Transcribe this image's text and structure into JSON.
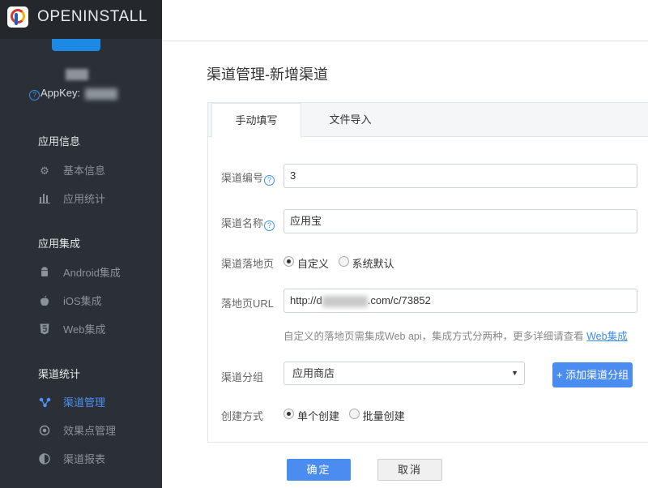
{
  "brand": {
    "name": "OPENINSTALL",
    "logo_icon": "openinstall-logo-icon"
  },
  "app": {
    "appkey_label": "AppKey:"
  },
  "sidebar": {
    "groups": [
      {
        "title": "应用信息",
        "items": [
          {
            "label": "基本信息",
            "icon": "gear-icon"
          },
          {
            "label": "应用统计",
            "icon": "bar-chart-icon"
          }
        ]
      },
      {
        "title": "应用集成",
        "items": [
          {
            "label": "Android集成",
            "icon": "android-icon"
          },
          {
            "label": "iOS集成",
            "icon": "apple-icon"
          },
          {
            "label": "Web集成",
            "icon": "html5-icon"
          }
        ]
      },
      {
        "title": "渠道统计",
        "items": [
          {
            "label": "渠道管理",
            "icon": "channel-icon",
            "active": true
          },
          {
            "label": "效果点管理",
            "icon": "target-icon"
          },
          {
            "label": "渠道报表",
            "icon": "pie-chart-icon"
          }
        ]
      }
    ]
  },
  "page": {
    "title": "渠道管理-新增渠道"
  },
  "tabs": [
    {
      "label": "手动填写",
      "active": true
    },
    {
      "label": "文件导入",
      "active": false
    }
  ],
  "form": {
    "channel_code": {
      "label": "渠道编号",
      "value": "3"
    },
    "channel_name": {
      "label": "渠道名称",
      "value": "应用宝"
    },
    "landing_page": {
      "label": "渠道落地页",
      "options": [
        {
          "label": "自定义",
          "checked": true
        },
        {
          "label": "系统默认",
          "checked": false
        }
      ]
    },
    "landing_url": {
      "label": "落地页URL",
      "value_prefix": "http://d",
      "value_suffix": ".com/c/73852"
    },
    "hint": {
      "text": "自定义的落地页需集成Web api，集成方式分两种，更多详细请查看 ",
      "link": "Web集成"
    },
    "channel_group": {
      "label": "渠道分组",
      "selected": "应用商店",
      "add_button": "+ 添加渠道分组"
    },
    "create_mode": {
      "label": "创建方式",
      "options": [
        {
          "label": "单个创建",
          "checked": true
        },
        {
          "label": "批量创建",
          "checked": false
        }
      ]
    }
  },
  "actions": {
    "confirm": "确定",
    "cancel": "取消"
  },
  "colors": {
    "sidebar_bg": "#2b3036",
    "accent": "#4a8cf0",
    "link": "#3b8de3"
  }
}
